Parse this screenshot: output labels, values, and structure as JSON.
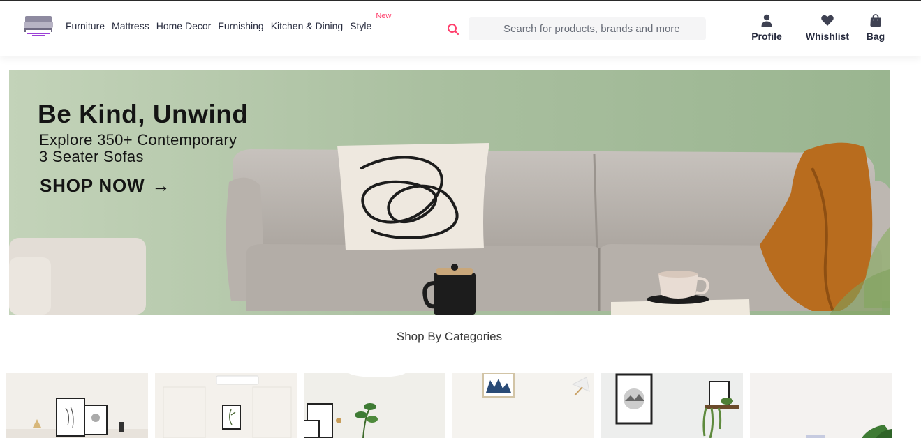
{
  "header": {
    "logo_alt": "logo",
    "nav": [
      {
        "label": "Furniture"
      },
      {
        "label": "Mattress"
      },
      {
        "label": "Home Decor"
      },
      {
        "label": "Furnishing"
      },
      {
        "label": "Kitchen & Dining"
      },
      {
        "label": "Style",
        "badge": "New"
      }
    ],
    "search": {
      "placeholder": "Search for products, brands and more",
      "icon": "search-icon"
    },
    "actions": [
      {
        "label": "Profile",
        "icon": "user-icon"
      },
      {
        "label": "Whishlist",
        "icon": "heart-icon"
      },
      {
        "label": "Bag",
        "icon": "bag-icon"
      }
    ]
  },
  "hero": {
    "title": "Be Kind, Unwind",
    "subtitle_line1": "Explore 350+ Contemporary",
    "subtitle_line2": "3 Seater Sofas",
    "cta": "SHOP NOW",
    "cta_arrow": "→"
  },
  "categories": {
    "title": "Shop By Categories"
  },
  "colors": {
    "accent": "#ff3f6c",
    "text": "#282c3f",
    "search_bg": "#f5f5f6",
    "hero_bg": "#a6bd9e"
  }
}
